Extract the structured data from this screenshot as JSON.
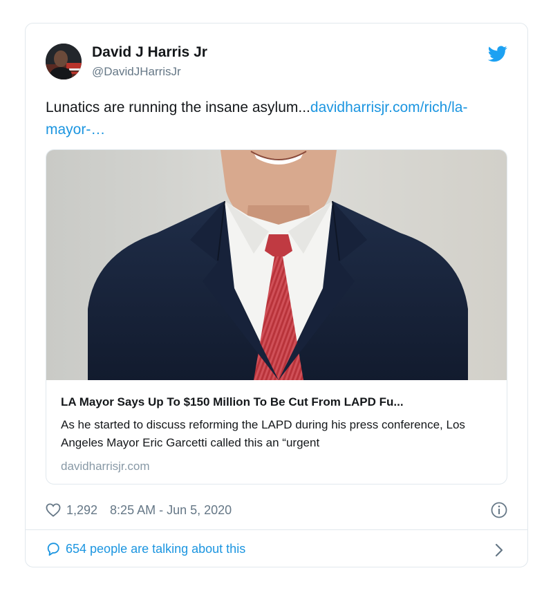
{
  "tweet": {
    "display_name": "David J Harris Jr",
    "handle": "@DavidJHarrisJr",
    "text_plain": "Lunatics are running the insane asylum...",
    "text_link": "davidharrisjr.com/rich/la-mayor-…",
    "card": {
      "title": "LA Mayor Says Up To $150 Million To Be Cut From LAPD Fu...",
      "description": "As he started to discuss reforming the LAPD during his press conference, Los Angeles Mayor Eric Garcetti called this an “urgent",
      "domain": "davidharrisjr.com"
    },
    "likes": "1,292",
    "timestamp": "8:25 AM - Jun 5, 2020",
    "talking": "654 people are talking about this"
  },
  "icons": {
    "brand": "twitter-bird-icon",
    "like": "heart-icon",
    "info": "info-icon",
    "reply": "speech-bubble-icon",
    "more": "chevron-right-icon"
  },
  "colors": {
    "link": "#1b95e0",
    "twitter_blue": "#1da1f2",
    "muted": "#657786",
    "border": "#e1e8ed"
  }
}
